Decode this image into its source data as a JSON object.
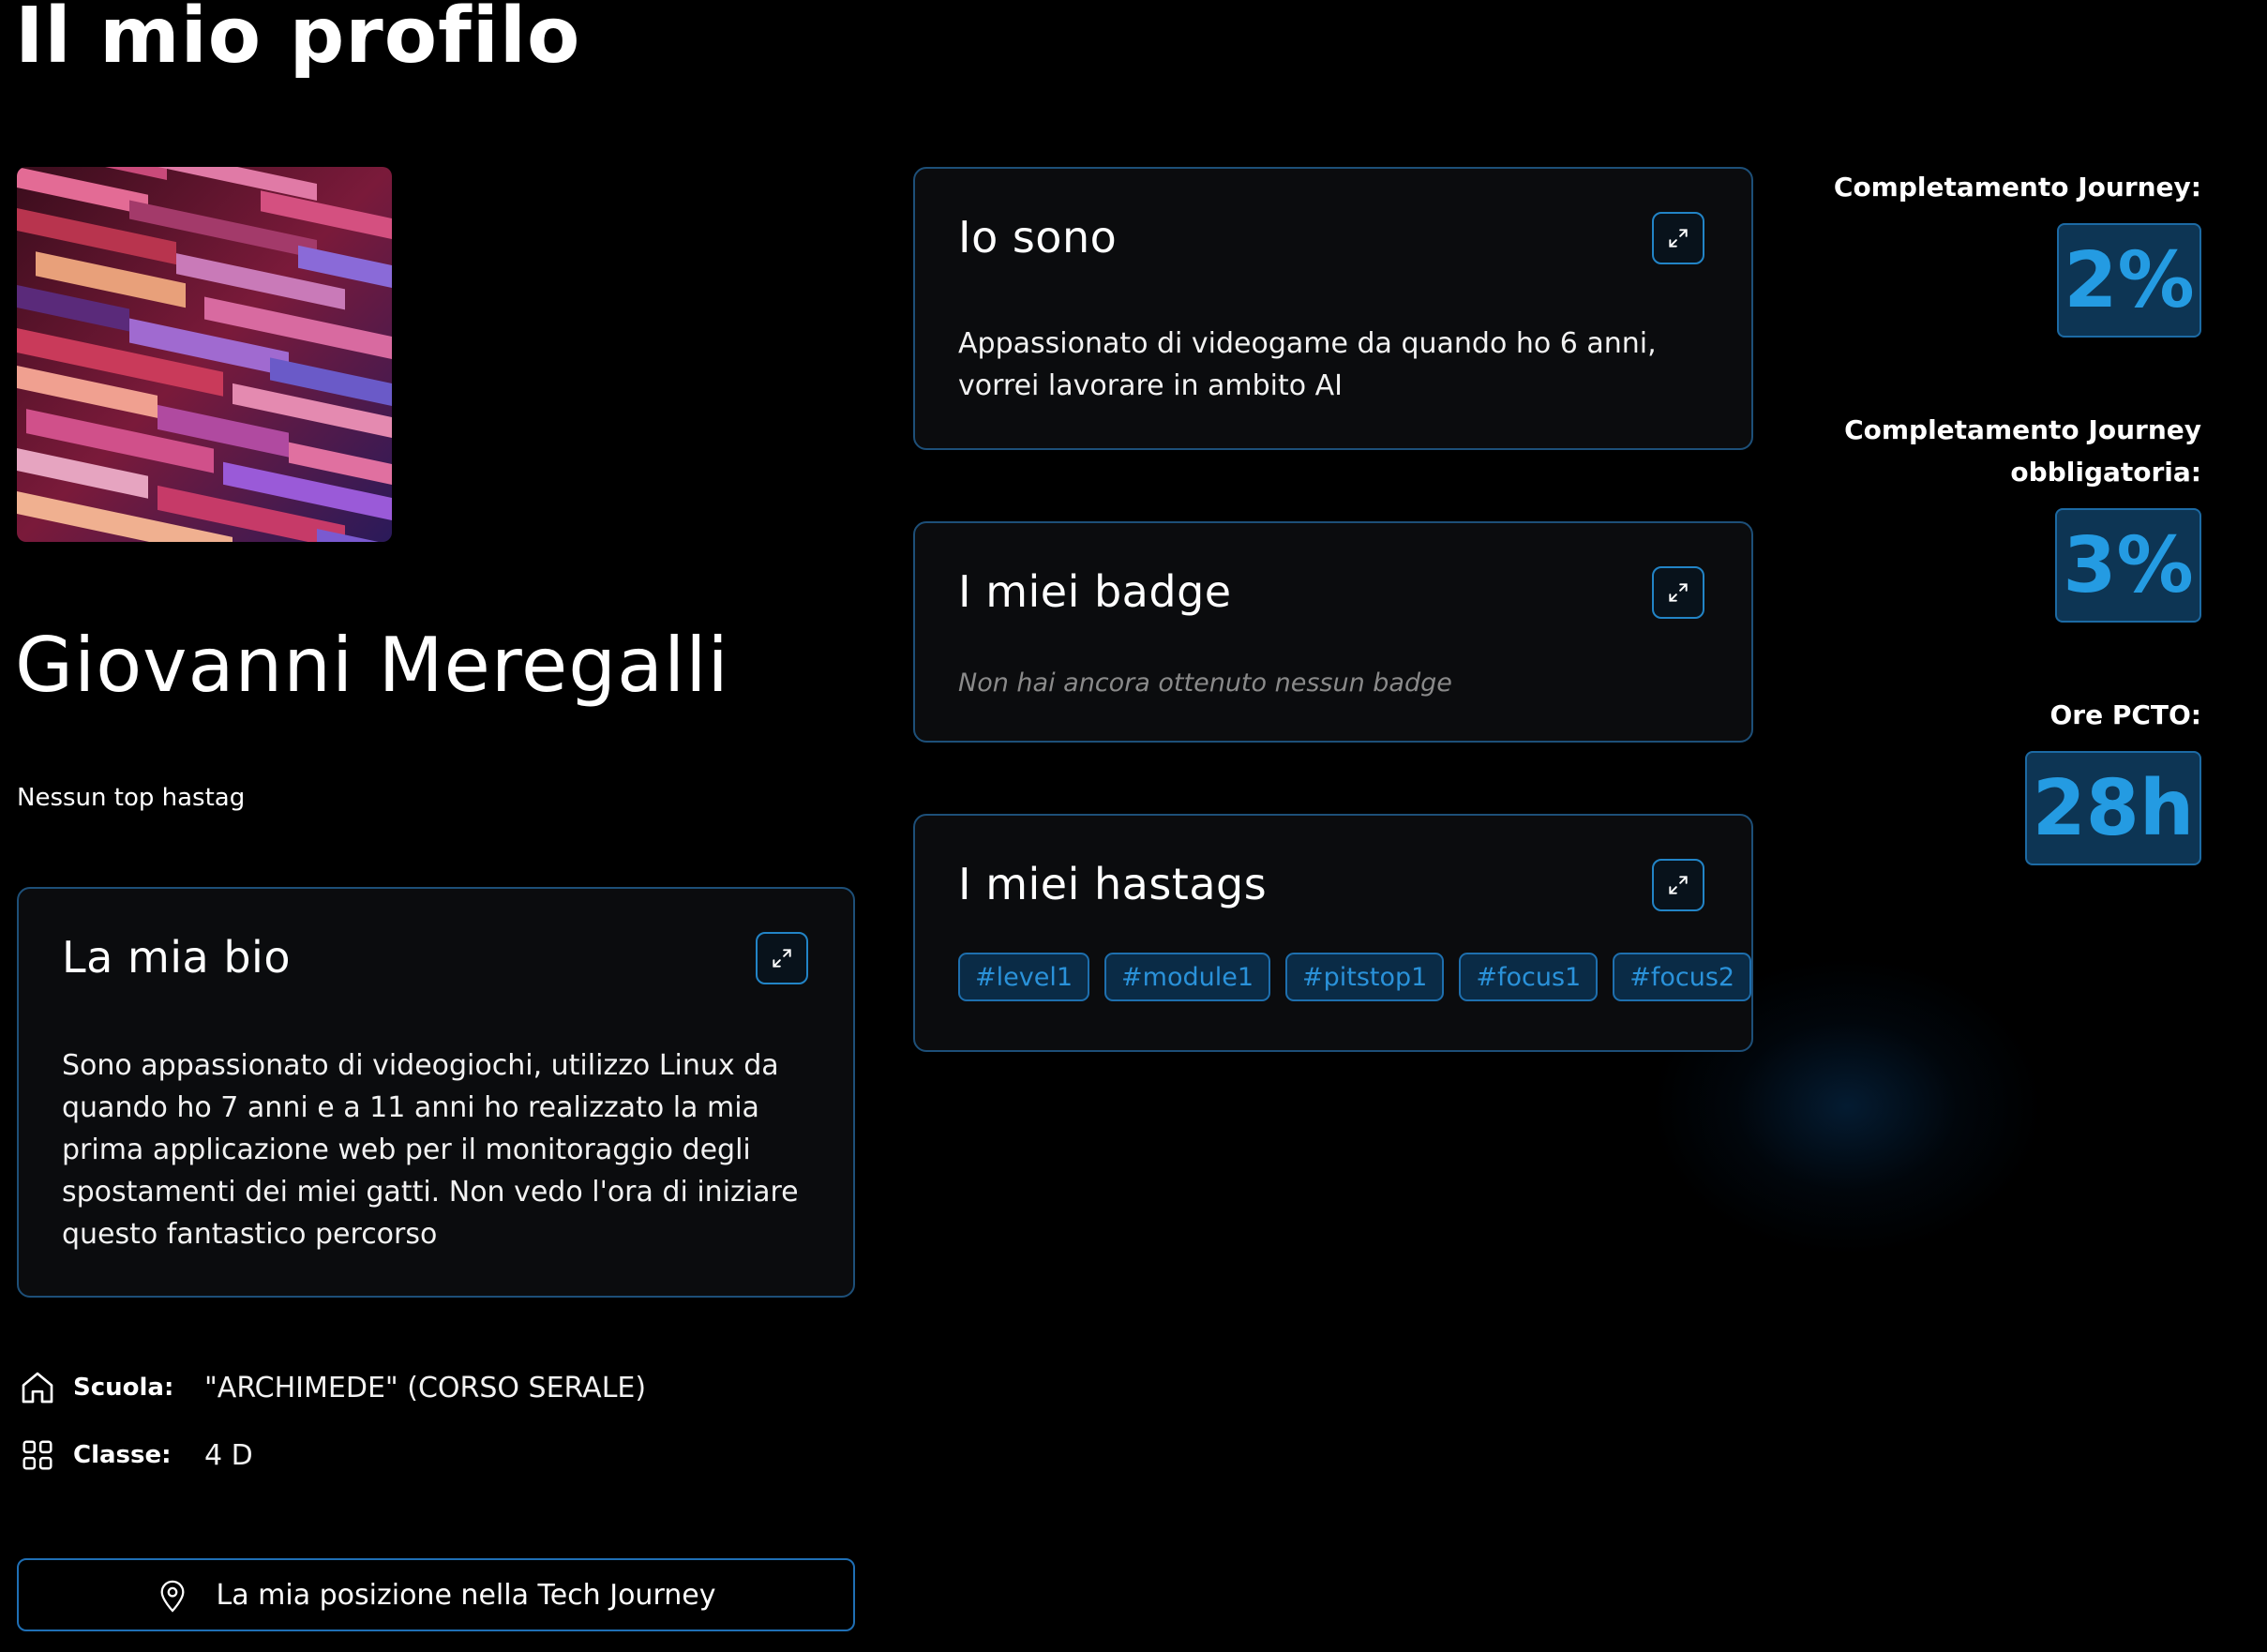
{
  "page": {
    "title": "Il mio profilo"
  },
  "profile": {
    "name": "Giovanni Meregalli",
    "top_hashtag": "Nessun top hastag"
  },
  "bio_card": {
    "title": "La mia bio",
    "text": "Sono appassionato di videogiochi, utilizzo Linux da quando ho 7 anni e a 11 anni ho realizzato la mia prima applicazione web per il monitoraggio degli spostamenti dei miei gatti. Non vedo l'ora di iniziare questo fantastico percorso"
  },
  "iam_card": {
    "title": "Io sono",
    "text": "Appassionato di videogame da quando ho 6 anni, vorrei lavorare in ambito AI"
  },
  "badge_card": {
    "title": "I miei badge",
    "empty_text": "Non hai ancora ottenuto nessun badge"
  },
  "hashtag_card": {
    "title": "I miei hastags",
    "tags": [
      "#level1",
      "#module1",
      "#pitstop1",
      "#focus1",
      "#focus2"
    ]
  },
  "stats": {
    "journey": {
      "label": "Completamento Journey:",
      "value": "2%"
    },
    "mandatory": {
      "label_line1": "Completamento Journey",
      "label_line2": "obbligatoria:",
      "value": "3%"
    },
    "pcto": {
      "label": "Ore PCTO:",
      "value": "28h"
    }
  },
  "info": {
    "school": {
      "label": "Scuola:",
      "value": "\"ARCHIMEDE\" (CORSO SERALE)",
      "icon": "home-icon"
    },
    "class": {
      "label": "Classe:",
      "value": "4 D",
      "icon": "grid-icon"
    }
  },
  "journey_button": {
    "label": "La mia posizione nella Tech Journey",
    "icon": "location-pin-icon"
  },
  "colors": {
    "accent": "#249be2",
    "border": "#1d4f78",
    "card_bg": "#0b0c0e",
    "background": "#000000"
  }
}
